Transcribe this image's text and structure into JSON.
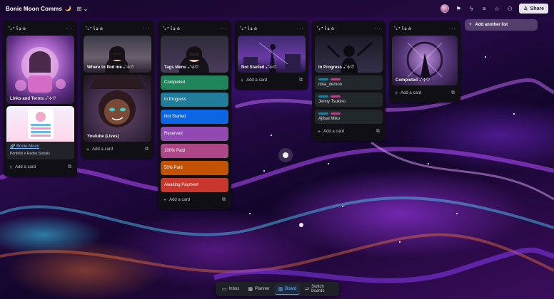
{
  "topbar": {
    "board_title": "Bonie Moon Comms",
    "title_emoji": "🌙",
    "view_switch": "⊞ ⌄",
    "share_label": "Share",
    "icons": [
      "power-up-icon",
      "automation-icon",
      "filter-icon",
      "star-icon",
      "members-icon"
    ]
  },
  "lists": [
    {
      "title": "˚₊‧꒰ა ☆",
      "cards": [
        {
          "type": "cover",
          "caption": "Links and Terms ₊˚⊹♡"
        },
        {
          "type": "link",
          "title": "🔗 Bonie Moon",
          "subtitle": "Portfólio e Redes Sociais"
        }
      ],
      "add_label": "Add a card"
    },
    {
      "title": "˚₊‧꒰ა ☆",
      "cards": [
        {
          "type": "cover",
          "caption": "Where to find me ₊˚⊹♡"
        },
        {
          "type": "cover",
          "caption": "Youtube (Lives)"
        }
      ],
      "add_label": "Add a card"
    },
    {
      "title": "˚₊‧꒰ა ☆",
      "cards": [
        {
          "type": "cover",
          "caption": "Tags Menu ₊˚⊹♡"
        }
      ],
      "labels": [
        {
          "text": "Completed",
          "color": "#1f845a"
        },
        {
          "text": "In Progress",
          "color": "#227d9b"
        },
        {
          "text": "Not Started",
          "color": "#0c66e4"
        },
        {
          "text": "Reserved",
          "color": "#8f49b1"
        },
        {
          "text": "100% Paid",
          "color": "#ae4787"
        },
        {
          "text": "50% Paid",
          "color": "#c25100"
        },
        {
          "text": "Awaiting Payment",
          "color": "#c9372c"
        }
      ],
      "add_label": "Add a card"
    },
    {
      "title": "˚₊‧꒰ა ☆",
      "cards": [
        {
          "type": "cover",
          "caption": "Not Started ₊˚⊹♡"
        }
      ],
      "add_label": "Add a card"
    },
    {
      "title": "˚₊‧꒰ა ☆",
      "cards": [
        {
          "type": "cover",
          "caption": "In Progress ₊˚⊹♡"
        },
        {
          "type": "plain",
          "title": "nina_demon",
          "tags": [
            "#227d9b",
            "#ae4787"
          ]
        },
        {
          "type": "plain",
          "title": "Jenny Tsukino",
          "tags": [
            "#227d9b",
            "#ae4787"
          ]
        },
        {
          "type": "plain",
          "title": "Ajiisai Miko",
          "tags": [
            "#227d9b",
            "#ae4787"
          ]
        }
      ],
      "add_label": "Add a card"
    },
    {
      "title": "˚₊‧꒰ა ☆",
      "cards": [
        {
          "type": "cover",
          "caption": "Completed ₊˚⊹♡"
        }
      ],
      "add_label": "Add a card"
    }
  ],
  "add_list_label": "Add another list",
  "bottom_nav": [
    {
      "label": "Inbox",
      "icon": "inbox-icon",
      "active": false
    },
    {
      "label": "Planner",
      "icon": "calendar-icon",
      "active": false
    },
    {
      "label": "Board",
      "icon": "board-icon",
      "active": true
    },
    {
      "label": "Switch boards",
      "icon": "switch-icon",
      "active": false
    }
  ]
}
